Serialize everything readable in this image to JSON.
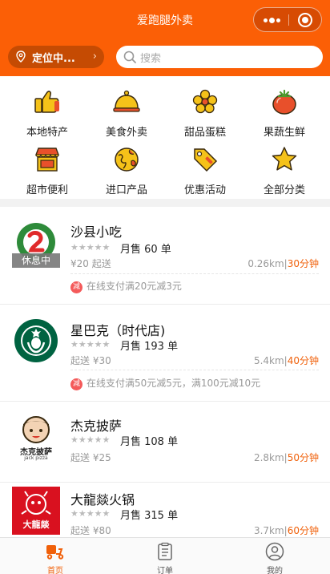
{
  "app": {
    "title": "爱跑腿外卖"
  },
  "header": {
    "location_label": "定位中...",
    "search_placeholder": "搜索"
  },
  "categories": [
    {
      "label": "本地特产",
      "icon": "thumbs-up-icon"
    },
    {
      "label": "美食外卖",
      "icon": "food-cloche-icon"
    },
    {
      "label": "甜品蛋糕",
      "icon": "flower-icon"
    },
    {
      "label": "果蔬生鲜",
      "icon": "tomato-icon"
    },
    {
      "label": "超市便利",
      "icon": "store-icon"
    },
    {
      "label": "进口产品",
      "icon": "globe-icon"
    },
    {
      "label": "优惠活动",
      "icon": "price-tag-icon"
    },
    {
      "label": "全部分类",
      "icon": "star-icon"
    }
  ],
  "stores": [
    {
      "name": "沙县小吃",
      "stars": "★★★★★",
      "sales": "月售 60 单",
      "min_order": "¥20 起送",
      "distance": "0.26km",
      "time": "30分钟",
      "status": "休息中",
      "promo": "在线支付满20元减3元",
      "promo_tag": "减",
      "logo": "shaxian-logo"
    },
    {
      "name": "星巴克（时代店)",
      "stars": "★★★★★",
      "sales": "月售 193 单",
      "min_order": "起送 ¥30",
      "distance": "5.4km",
      "time": "40分钟",
      "promo": "在线支付满50元减5元，满100元减10元",
      "promo_tag": "减",
      "logo": "starbucks-logo"
    },
    {
      "name": "杰克披萨",
      "stars": "★★★★★",
      "sales": "月售 108 单",
      "min_order": "起送 ¥25",
      "distance": "2.8km",
      "time": "50分钟",
      "logo": "jack-pizza-logo",
      "logo_text_cn": "杰克披萨",
      "logo_text_en": "jack pizza"
    },
    {
      "name": "大龍燚火锅",
      "stars": "★★★★★",
      "sales": "月售 315 单",
      "min_order": "起送 ¥80",
      "distance": "3.7km",
      "time": "60分钟",
      "logo": "dalongyi-logo",
      "logo_text_cn": "大龍燚"
    }
  ],
  "tabbar": [
    {
      "label": "首页",
      "icon": "scooter-icon",
      "active": true
    },
    {
      "label": "订单",
      "icon": "order-list-icon",
      "active": false
    },
    {
      "label": "我的",
      "icon": "user-icon",
      "active": false
    }
  ],
  "colors": {
    "brand": "#fb5f06",
    "accent_text": "#f0600a",
    "promo_tag": "#f45a5a"
  }
}
